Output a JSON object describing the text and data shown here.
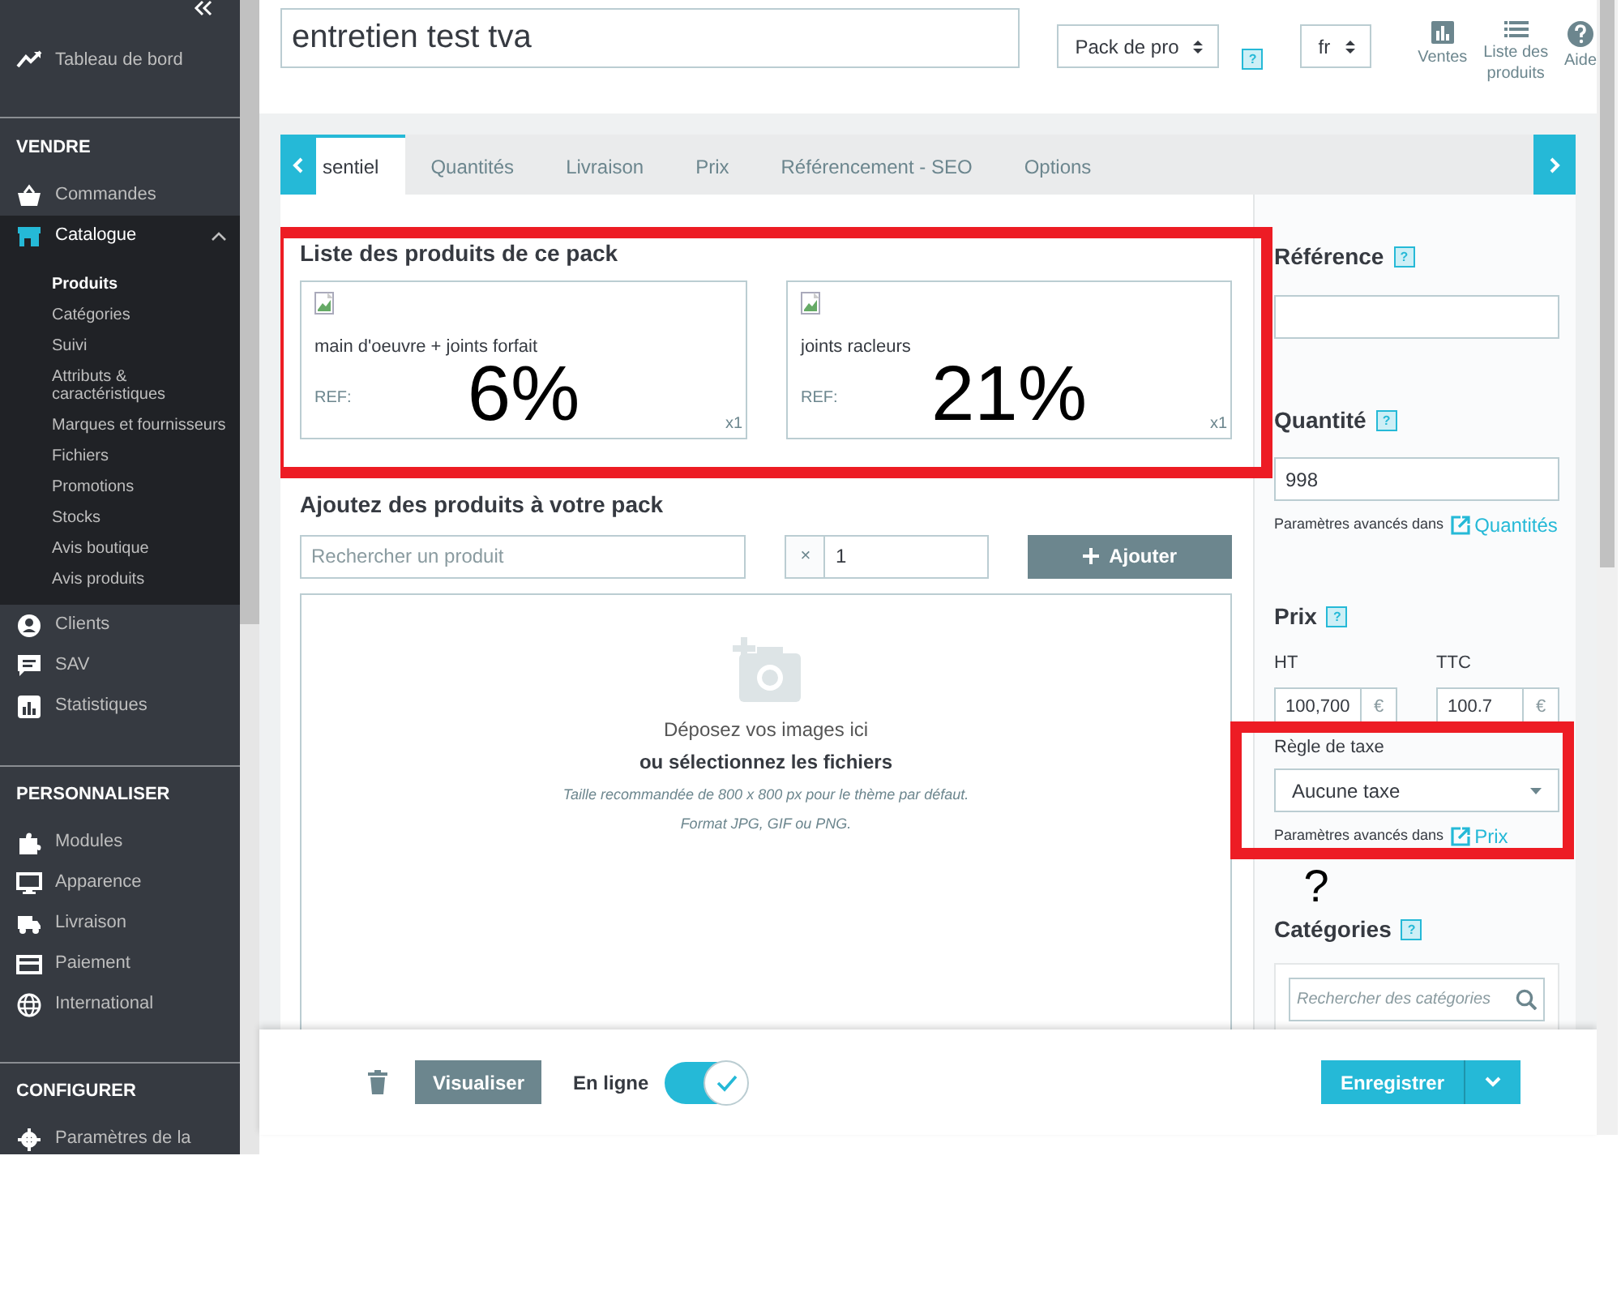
{
  "sidebar": {
    "groups": [
      {
        "items": [
          {
            "label": "Tableau de bord",
            "selected": false,
            "expanded": false
          }
        ]
      },
      {
        "heading": "VENDRE",
        "items": [
          {
            "label": "Commandes",
            "selected": false,
            "expanded": false
          },
          {
            "label": "Catalogue",
            "selected": true,
            "expanded": true,
            "children": [
              {
                "label": "Produits",
                "selected": true
              },
              {
                "label": "Catégories",
                "selected": false
              },
              {
                "label": "Suivi",
                "selected": false
              },
              {
                "label": "Attributs & caractéristiques",
                "selected": false
              },
              {
                "label": "Marques et fournisseurs",
                "selected": false
              },
              {
                "label": "Fichiers",
                "selected": false
              },
              {
                "label": "Promotions",
                "selected": false
              },
              {
                "label": "Stocks",
                "selected": false
              },
              {
                "label": "Avis boutique",
                "selected": false
              },
              {
                "label": "Avis produits",
                "selected": false
              }
            ]
          },
          {
            "label": "Clients",
            "selected": false,
            "expanded": false
          },
          {
            "label": "SAV",
            "selected": false,
            "expanded": false
          },
          {
            "label": "Statistiques",
            "selected": false,
            "expanded": false
          }
        ]
      },
      {
        "heading": "PERSONNALISER",
        "items": [
          {
            "label": "Modules",
            "selected": false,
            "expanded": false
          },
          {
            "label": "Apparence",
            "selected": false,
            "expanded": false
          },
          {
            "label": "Livraison",
            "selected": false,
            "expanded": false
          },
          {
            "label": "Paiement",
            "selected": false,
            "expanded": false
          },
          {
            "label": "International",
            "selected": false,
            "expanded": false
          }
        ]
      },
      {
        "heading": "CONFIGURER",
        "items": [
          {
            "label": "Paramètres de la",
            "selected": false,
            "expanded": false
          }
        ]
      }
    ]
  },
  "header": {
    "product_name": "entretien test tva",
    "type_select": "Pack de pro",
    "type_help": "?",
    "lang_select": "fr",
    "toolbar": [
      {
        "label": "Ventes"
      },
      {
        "label": "Liste des produits"
      },
      {
        "label": "Aide"
      }
    ]
  },
  "tabs": [
    {
      "label": "sentiel",
      "selected": true
    },
    {
      "label": "Quantités",
      "selected": false
    },
    {
      "label": "Livraison",
      "selected": false
    },
    {
      "label": "Prix",
      "selected": false
    },
    {
      "label": "Référencement - SEO",
      "selected": false
    },
    {
      "label": "Options",
      "selected": false
    }
  ],
  "pack": {
    "title": "Liste des produits de ce pack",
    "highlighted": true,
    "products": [
      {
        "name": "main d'oeuvre + joints forfait",
        "ref_label": "REF:",
        "quantity": "x1",
        "annotation": "6%"
      },
      {
        "name": "joints racleurs",
        "ref_label": "REF:",
        "quantity": "x1",
        "annotation": "21%"
      }
    ]
  },
  "add_products": {
    "title": "Ajoutez des produits à votre pack",
    "search": {
      "placeholder": "Rechercher un produit"
    },
    "quantity": {
      "prefix": "×",
      "value": "1"
    },
    "button": "Ajouter"
  },
  "dropzone": {
    "line1": "Déposez vos images ici",
    "line2": "ou sélectionnez les fichiers",
    "hint1": "Taille recommandée de 800 x 800 px pour le thème par défaut.",
    "hint2": "Format JPG, GIF ou PNG."
  },
  "reference": {
    "title": "Référence",
    "help": "?"
  },
  "quantity": {
    "title": "Quantité",
    "help": "?",
    "value": "998",
    "advanced_text": "Paramètres avancés dans",
    "advanced_link": "Quantités"
  },
  "price": {
    "title": "Prix",
    "help": "?",
    "ht_label": "HT",
    "ht_value": "100,700",
    "ht_currency": "€",
    "ttc_label": "TTC",
    "ttc_value": "100.7",
    "ttc_currency": "€"
  },
  "tax_rule": {
    "label": "Règle de taxe",
    "value": "Aucune taxe",
    "advanced_text": "Paramètres avancés dans",
    "advanced_link": "Prix",
    "highlighted": true,
    "annotation": "?"
  },
  "categories": {
    "title": "Catégories",
    "help": "?",
    "search": {
      "placeholder": "Rechercher des catégories"
    }
  },
  "footer": {
    "preview_button": "Visualiser",
    "online_label": "En ligne",
    "online": true,
    "save_button": "Enregistrer"
  }
}
